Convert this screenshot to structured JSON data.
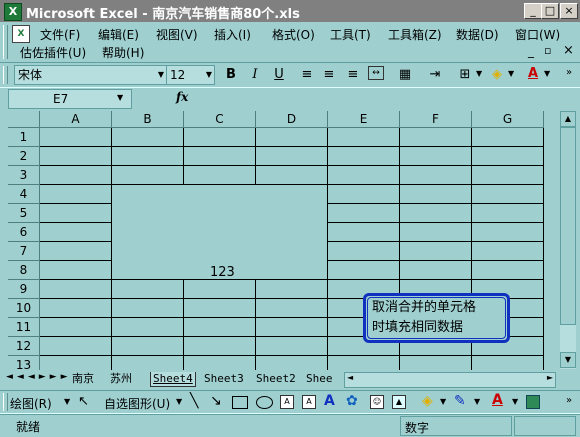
{
  "window": {
    "title": "Microsoft Excel - 南京汽车销售商80个.xls",
    "min": "_",
    "max": "□",
    "close": "×"
  },
  "menu": {
    "items": [
      "文件(F)",
      "编辑(E)",
      "视图(V)",
      "插入(I)",
      "格式(O)",
      "工具(T)",
      "工具箱(Z)",
      "数据(D)",
      "窗口(W)"
    ],
    "row2": [
      "估佐插件(U)",
      "帮助(H)"
    ]
  },
  "format_toolbar": {
    "font": "宋体",
    "size": "12",
    "bold": "B",
    "italic": "I",
    "underline": "U",
    "font_color_label": "A"
  },
  "formula_bar": {
    "name_box": "E7",
    "fx": "fx",
    "formula": ""
  },
  "grid": {
    "columns": [
      "A",
      "B",
      "C",
      "D",
      "E",
      "F",
      "G"
    ],
    "rows": [
      "1",
      "2",
      "3",
      "4",
      "5",
      "6",
      "7",
      "8",
      "9",
      "10",
      "11",
      "12",
      "13"
    ],
    "merged_value": "123"
  },
  "note": {
    "line1": "取消合并的单元格",
    "line2": "时填充相同数据"
  },
  "sheet_tabs": [
    "南京",
    "苏州",
    "Sheet4",
    "Sheet3",
    "Sheet2",
    "Shee"
  ],
  "drawing_toolbar": {
    "draw": "绘图(R)",
    "autoshapes": "自选图形(U)",
    "font_color": "A"
  },
  "status": {
    "left": "就绪",
    "mode": "数字"
  }
}
